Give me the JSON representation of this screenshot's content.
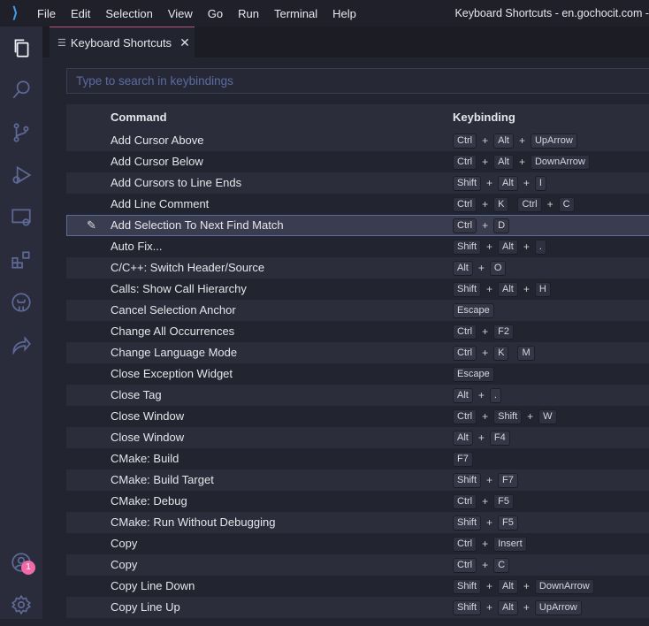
{
  "titlebar": {
    "menus": [
      "File",
      "Edit",
      "Selection",
      "View",
      "Go",
      "Run",
      "Terminal",
      "Help"
    ],
    "window_title": "Keyboard Shortcuts - en.gochocit.com -"
  },
  "tab": {
    "label": "Keyboard Shortcuts"
  },
  "search": {
    "placeholder": "Type to search in keybindings"
  },
  "table": {
    "headers": {
      "command": "Command",
      "keybinding": "Keybinding"
    },
    "selected_index": 4,
    "rows": [
      {
        "command": "Add Cursor Above",
        "keys": [
          [
            "Ctrl",
            "Alt",
            "UpArrow"
          ]
        ]
      },
      {
        "command": "Add Cursor Below",
        "keys": [
          [
            "Ctrl",
            "Alt",
            "DownArrow"
          ]
        ]
      },
      {
        "command": "Add Cursors to Line Ends",
        "keys": [
          [
            "Shift",
            "Alt",
            "I"
          ]
        ]
      },
      {
        "command": "Add Line Comment",
        "keys": [
          [
            "Ctrl",
            "K"
          ],
          [
            "Ctrl",
            "C"
          ]
        ]
      },
      {
        "command": "Add Selection To Next Find Match",
        "keys": [
          [
            "Ctrl",
            "D"
          ]
        ]
      },
      {
        "command": "Auto Fix...",
        "keys": [
          [
            "Shift",
            "Alt",
            "."
          ]
        ]
      },
      {
        "command": "C/C++: Switch Header/Source",
        "keys": [
          [
            "Alt",
            "O"
          ]
        ]
      },
      {
        "command": "Calls: Show Call Hierarchy",
        "keys": [
          [
            "Shift",
            "Alt",
            "H"
          ]
        ]
      },
      {
        "command": "Cancel Selection Anchor",
        "keys": [
          [
            "Escape"
          ]
        ]
      },
      {
        "command": "Change All Occurrences",
        "keys": [
          [
            "Ctrl",
            "F2"
          ]
        ]
      },
      {
        "command": "Change Language Mode",
        "keys": [
          [
            "Ctrl",
            "K"
          ],
          [
            "M"
          ]
        ]
      },
      {
        "command": "Close Exception Widget",
        "keys": [
          [
            "Escape"
          ]
        ]
      },
      {
        "command": "Close Tag",
        "keys": [
          [
            "Alt",
            "."
          ]
        ]
      },
      {
        "command": "Close Window",
        "keys": [
          [
            "Ctrl",
            "Shift",
            "W"
          ]
        ]
      },
      {
        "command": "Close Window",
        "keys": [
          [
            "Alt",
            "F4"
          ]
        ]
      },
      {
        "command": "CMake: Build",
        "keys": [
          [
            "F7"
          ]
        ]
      },
      {
        "command": "CMake: Build Target",
        "keys": [
          [
            "Shift",
            "F7"
          ]
        ]
      },
      {
        "command": "CMake: Debug",
        "keys": [
          [
            "Ctrl",
            "F5"
          ]
        ]
      },
      {
        "command": "CMake: Run Without Debugging",
        "keys": [
          [
            "Shift",
            "F5"
          ]
        ]
      },
      {
        "command": "Copy",
        "keys": [
          [
            "Ctrl",
            "Insert"
          ]
        ]
      },
      {
        "command": "Copy",
        "keys": [
          [
            "Ctrl",
            "C"
          ]
        ]
      },
      {
        "command": "Copy Line Down",
        "keys": [
          [
            "Shift",
            "Alt",
            "DownArrow"
          ]
        ]
      },
      {
        "command": "Copy Line Up",
        "keys": [
          [
            "Shift",
            "Alt",
            "UpArrow"
          ]
        ]
      }
    ]
  },
  "activity": {
    "accounts_badge": "1"
  }
}
